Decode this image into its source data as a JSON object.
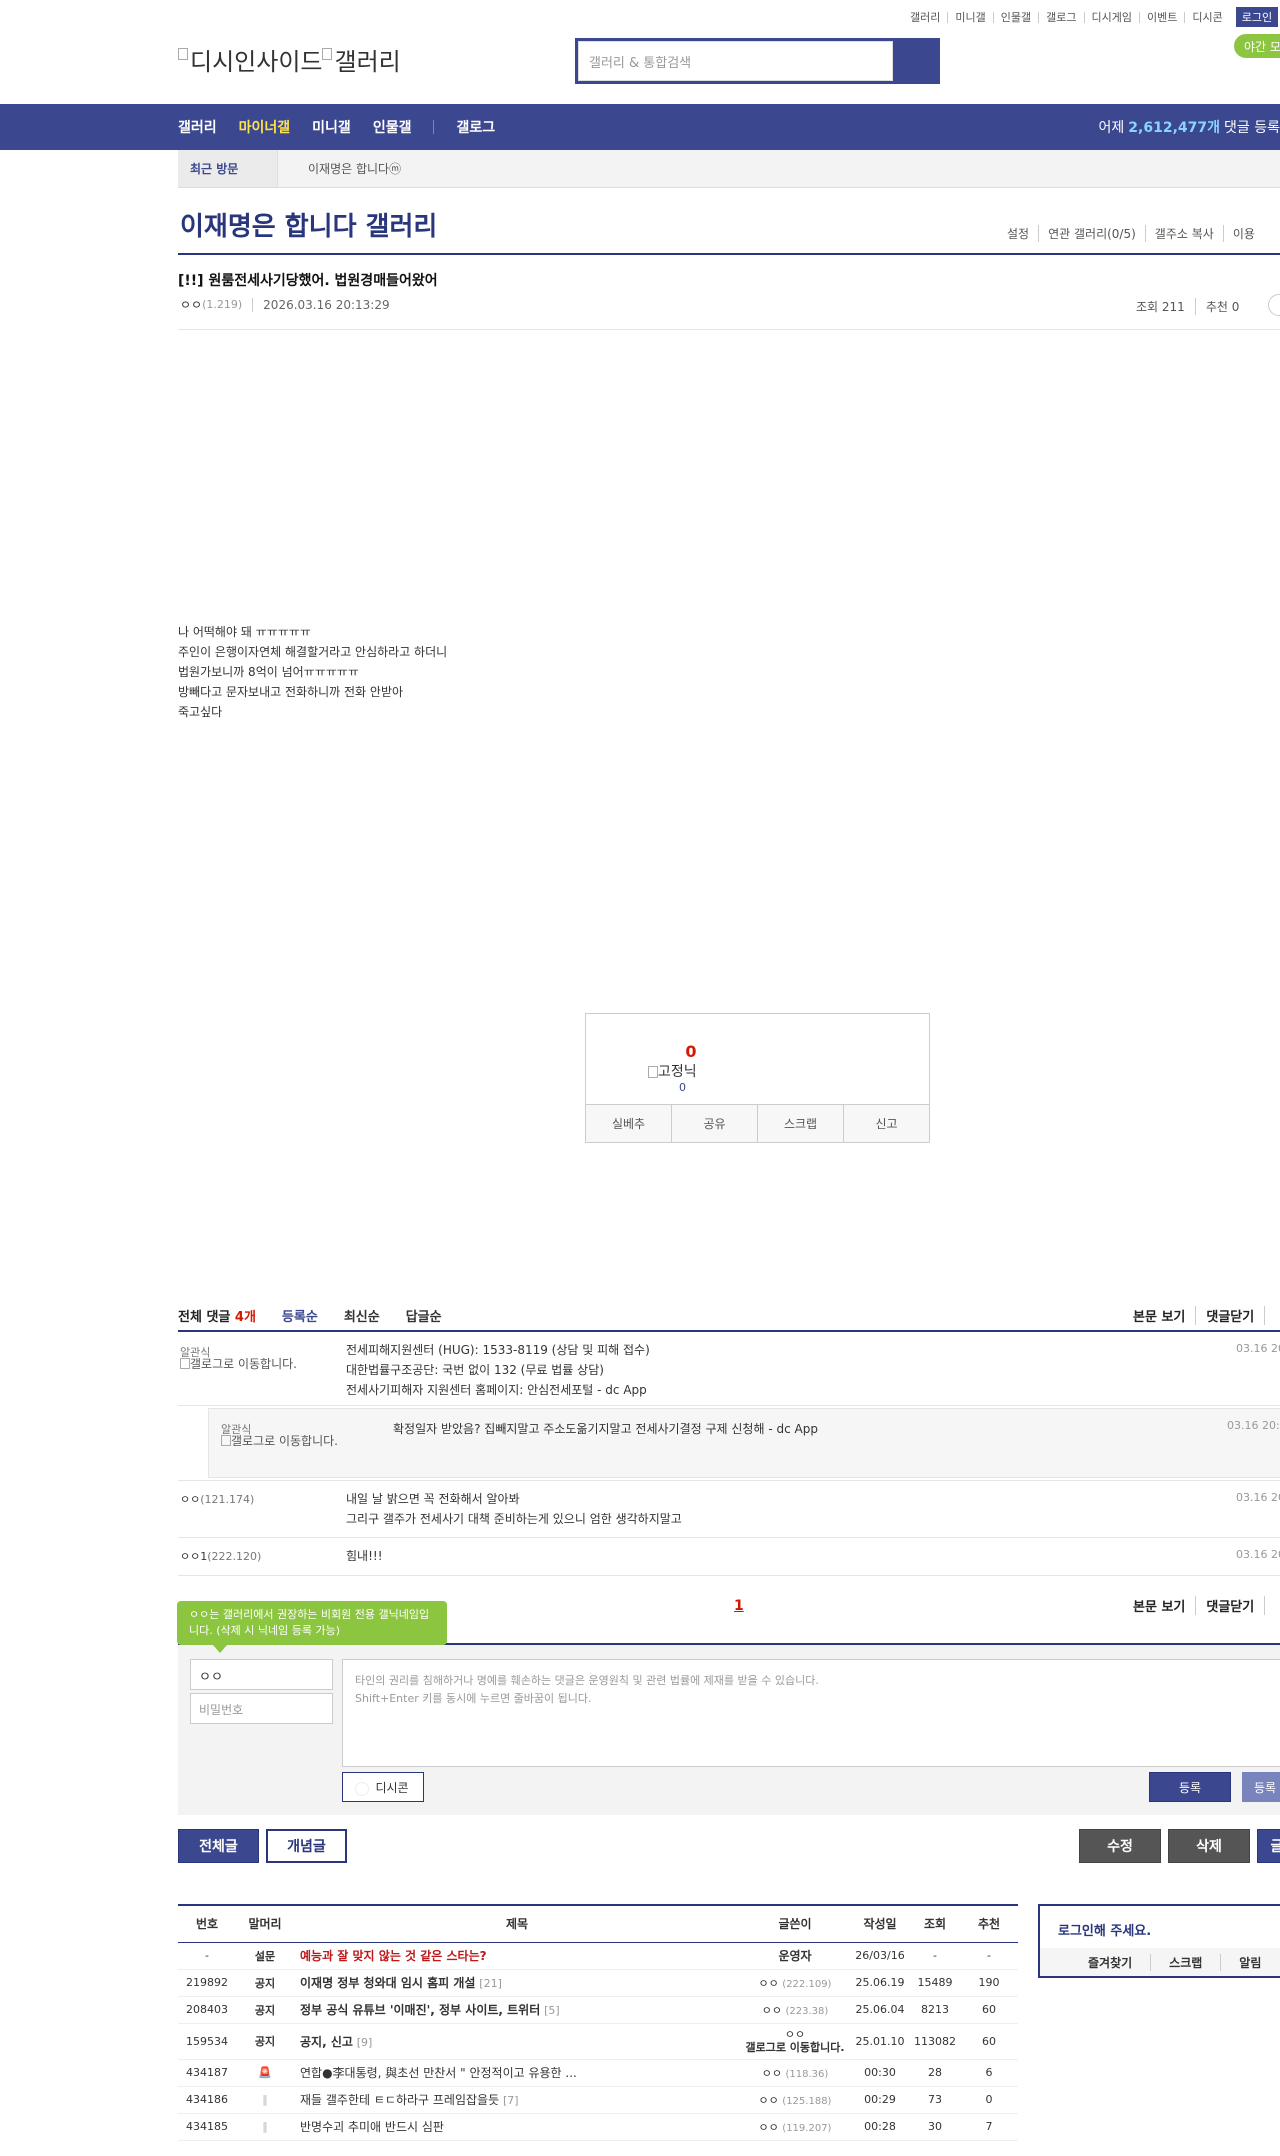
{
  "util_links": [
    "갤러리",
    "미니갤",
    "인물갤",
    "갤로그",
    "디시게임",
    "이벤트",
    "디시콘"
  ],
  "login_label": "로그인",
  "logo": {
    "site": "디시인사이드",
    "section": "갤러리"
  },
  "search": {
    "placeholder": "갤러리 & 통합검색"
  },
  "night_mode": "야간 모",
  "gnb": {
    "items": [
      "갤러리",
      "마이너갤",
      "미니갤",
      "인물갤"
    ],
    "gallog": "갤로그",
    "stat_prefix": "어제",
    "stat_value": "2,612,477개",
    "stat_suffix": "댓글 등록"
  },
  "recent": {
    "label": "최근 방문",
    "item": "이재명은 합니다ⓜ"
  },
  "gallery": {
    "title": "이재명은 합니다 갤러리",
    "options": [
      "설정",
      "연관 갤러리(0/5)",
      "갤주소 복사",
      "이용"
    ]
  },
  "post": {
    "title": "[!!] 원룸전세사기당했어. 법원경매들어왔어",
    "nick": "ㅇㅇ",
    "ip": "(1.219)",
    "date": "2026.03.16 20:13:29",
    "views": "조회 211",
    "recommend": "추천 0",
    "body": [
      "나 어떡해야 돼 ㅠㅠㅠㅠㅠ",
      "주인이 은행이자연체 해결할거라고 안심하라고 하더니",
      "법원가보니까 8억이 넘어ㅠㅠㅠㅠㅠ",
      "방빼다고 문자보내고 전화하니까 전화 안받아",
      "죽고싶다"
    ]
  },
  "reco": {
    "count": "0",
    "fixed_nick": "고정닉",
    "fixed_count": "0",
    "buttons": [
      "실베추",
      "공유",
      "스크랩",
      "신고"
    ]
  },
  "comments": {
    "title": "전체 댓글",
    "count": "4개",
    "tabs": [
      "등록순",
      "최신순",
      "답글순"
    ],
    "right": [
      "본문 보기",
      "댓글닫기"
    ],
    "items": [
      {
        "nick": "알관식",
        "img_alt": "갤로그로 이동합니다.",
        "lines": [
          "전세피해지원센터 (HUG): 1533-8119 (상담 및 피해 접수)",
          "대한법률구조공단: 국번 없이 132 (무료 법률 상담)",
          "전세사기피해자 지원센터 홈페이지: 안심전세포털 - dc App"
        ],
        "date": "03.16 20"
      },
      {
        "nick": "알관식",
        "img_alt": "갤로그로 이동합니다.",
        "lines": [
          "확정일자 받았음? 집빼지말고 주소도옮기지말고 전세사기결정 구제 신청해 - dc App"
        ],
        "date": "03.16 20:2"
      },
      {
        "nick": "ㅇㅇ",
        "ip": "(121.174)",
        "lines": [
          "내일 날 밝으면 꼭 전화해서 알아봐",
          "그리구 갤주가 전세사기 대책 준비하는게 있으니 엄한 생각하지말고"
        ],
        "date": "03.16 20"
      },
      {
        "nick": "ㅇㅇ1",
        "ip": "(222.120)",
        "lines": [
          "힘내!!!"
        ],
        "date": "03.16 20"
      }
    ],
    "page": "1"
  },
  "write": {
    "tip": "ㅇㅇ는 갤러리에서 권장하는 비회원 전용 갤닉네임입니다. (삭제 시 닉네임 등록 가능)",
    "nick_value": "ㅇㅇ",
    "pw_placeholder": "비밀번호",
    "textarea": [
      "타인의 권리를 침해하거나 명예를 훼손하는 댓글은 운영원칙 및 관련 법률에 제재를 받을 수 있습니다.",
      "Shift+Enter 키를 동시에 누르면 줄바꿈이 됩니다."
    ],
    "dccon": "디시콘",
    "register": "등록",
    "register2": "등록"
  },
  "buttons": {
    "all": "전체글",
    "concept": "개념글",
    "edit": "수정",
    "delete": "삭제",
    "write": "글"
  },
  "list": {
    "headers": [
      "번호",
      "말머리",
      "제목",
      "글쓴이",
      "작성일",
      "조회",
      "추천"
    ],
    "rows": [
      {
        "no": "-",
        "head": "설문",
        "title": "예능과 잘 맞지 않는 것 같은 스타는?",
        "cnt": "",
        "writer": "운영자",
        "ip": "",
        "date": "26/03/16",
        "views": "-",
        "rec": "-",
        "style": "red"
      },
      {
        "no": "219892",
        "head": "공지",
        "title": "이재명 정부 청와대 임시 홈피 개설",
        "cnt": "[21]",
        "writer": "ㅇㅇ",
        "ip": "(222.109)",
        "date": "25.06.19",
        "views": "15489",
        "rec": "190",
        "style": "bold"
      },
      {
        "no": "208403",
        "head": "공지",
        "title": "정부 공식 유튜브 '이매진', 정부 사이트, 트위터",
        "cnt": "[5]",
        "writer": "ㅇㅇ",
        "ip": "(223.38)",
        "date": "25.06.04",
        "views": "8213",
        "rec": "60",
        "style": "bold"
      },
      {
        "no": "159534",
        "head": "공지",
        "title": "공지, 신고",
        "cnt": "[9]",
        "writer": "ㅇㅇ",
        "ip": "갤로그로 이동합니다.",
        "date": "25.01.10",
        "views": "113082",
        "rec": "60",
        "style": "bold"
      },
      {
        "no": "434187",
        "head": "🚨",
        "title": "연합●李대통령, 與초선 만찬서 \" 안정적이고 유용한 ...",
        "cnt": "",
        "writer": "ㅇㅇ",
        "ip": "(118.36)",
        "date": "00:30",
        "views": "28",
        "rec": "6",
        "style": ""
      },
      {
        "no": "434186",
        "head": "‖",
        "title": "재들 갤주한테 ㅌㄷ하라구 프레임잡을듯",
        "cnt": "[7]",
        "writer": "ㅇㅇ",
        "ip": "(125.188)",
        "date": "00:29",
        "views": "73",
        "rec": "0",
        "style": ""
      },
      {
        "no": "434185",
        "head": "‖",
        "title": "반명수괴 추미애 반드시 심판",
        "cnt": "",
        "writer": "ㅇㅇ",
        "ip": "(119.207)",
        "date": "00:28",
        "views": "30",
        "rec": "7",
        "style": ""
      }
    ]
  },
  "loginbox": {
    "title": "로그인해 주세요.",
    "links": [
      "즐겨찾기",
      "스크랩",
      "알림"
    ]
  },
  "colors": {
    "brand": "#3b4890",
    "accent": "#8cc53f",
    "highlight": "#ffe34d",
    "red": "#d31900"
  }
}
